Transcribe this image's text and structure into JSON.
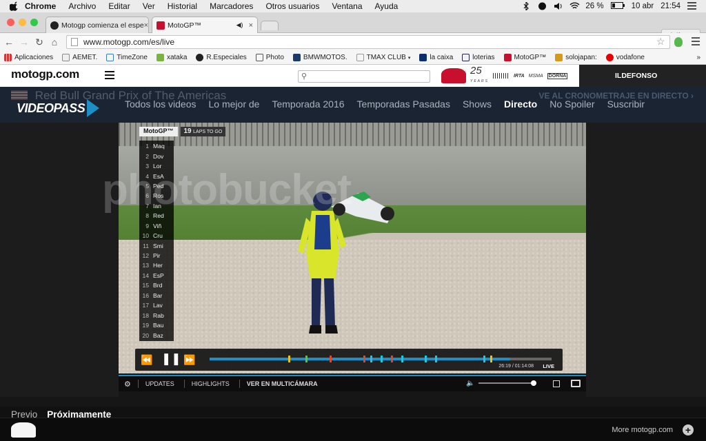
{
  "menubar": {
    "items": [
      "Chrome",
      "Archivo",
      "Editar",
      "Ver",
      "Historial",
      "Marcadores",
      "Otros usuarios",
      "Ventana",
      "Ayuda"
    ],
    "battery": "26 %",
    "date": "10 abr",
    "time": "21:54"
  },
  "browser": {
    "tabs": [
      {
        "title": "Motogp comienza el espe"
      },
      {
        "title": "MotoGP™"
      }
    ],
    "profile": "Idelfonso",
    "url": "www.motogp.com/es/live",
    "bookmarks": [
      "Aplicaciones",
      "AEMET.",
      "TimeZone",
      "xataka",
      "R.Especiales",
      "Photo",
      "BMWMOTOS.",
      "TMAX CLUB",
      "la caixa",
      "loterias",
      "MotoGP™",
      "solojapan:",
      "vodafone"
    ]
  },
  "site": {
    "logo": "motogp.com",
    "user": "ILDEFONSO",
    "sponsor_25": "25",
    "sponsor_years": "YEARS",
    "sponsor_irta": "IRTA",
    "sponsor_msma": "MSMA",
    "sponsor_dorna": "DORNA"
  },
  "videopass": {
    "event_title": "Red Bull Grand Prix of The Americas",
    "crono_link": "VE AL CRONOMETRAJE EN DIRECTO",
    "logo": "VIDEOPASS",
    "menu": [
      "Todos los videos",
      "Lo mejor de",
      "Temporada 2016",
      "Temporadas Pasadas",
      "Shows",
      "Directo",
      "No Spoiler",
      "Suscribir"
    ],
    "active_menu": "Directo"
  },
  "player": {
    "standings_series": "MotoGP™",
    "laps_to_go": "19",
    "laps_label": "LAPS TO GO",
    "riders": [
      "Maq",
      "Dov",
      "Lor",
      "EsA",
      "Ped",
      "Ros",
      "Ian",
      "Red",
      "Viñ",
      "Cru",
      "Smi",
      "Pir",
      "Her",
      "EsP",
      "Brd",
      "Bar",
      "Lav",
      "Rab",
      "Bau",
      "Baz"
    ],
    "progress_fraction": 0.88,
    "time_readout": "26:19 / 01:14:08",
    "live_badge": "LIVE",
    "strip_items": [
      "UPDATES",
      "HIGHLIGHTS",
      "VER EN MULTICÁMARA"
    ],
    "volume_fraction": 0.95,
    "marker_colors": [
      "#e8c21b",
      "#4ecf3a",
      "#d84a3a",
      "#21c5e0"
    ]
  },
  "below": {
    "tabs": [
      "Previo",
      "Próximamente"
    ]
  },
  "footer": {
    "more": "More motogp.com"
  },
  "watermark": "photobucket"
}
